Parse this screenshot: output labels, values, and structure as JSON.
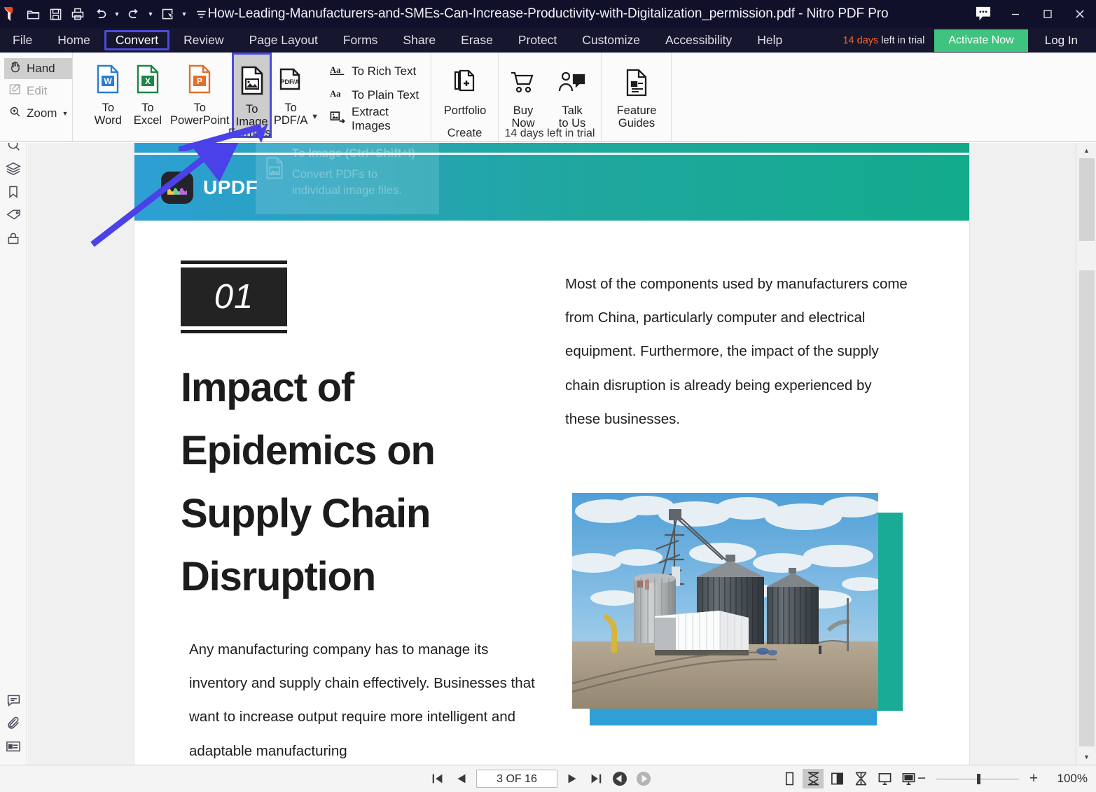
{
  "window": {
    "title": "How-Leading-Manufacturers-and-SMEs-Can-Increase-Productivity-with-Digitalization_permission.pdf - Nitro PDF Pro",
    "quick_access": [
      "open-icon",
      "save-icon",
      "print-icon",
      "undo-icon",
      "redo-icon",
      "select-icon",
      "more-icon"
    ],
    "controls": {
      "chat": "chat-icon",
      "minimize": "–",
      "maximize": "□",
      "close": "✕"
    }
  },
  "menu": {
    "items": [
      {
        "label": "File",
        "active": false
      },
      {
        "label": "Home",
        "active": false
      },
      {
        "label": "Convert",
        "active": true
      },
      {
        "label": "Review",
        "active": false
      },
      {
        "label": "Page Layout",
        "active": false
      },
      {
        "label": "Forms",
        "active": false
      },
      {
        "label": "Share",
        "active": false
      },
      {
        "label": "Erase",
        "active": false
      },
      {
        "label": "Protect",
        "active": false
      },
      {
        "label": "Customize",
        "active": false
      },
      {
        "label": "Accessibility",
        "active": false
      },
      {
        "label": "Help",
        "active": false
      }
    ],
    "trial_days": "14 days",
    "trial_rest": " left in trial",
    "activate_label": "Activate Now",
    "login_label": "Log In",
    "accent_green": "#3fc37e",
    "accent_orange": "#f4652c",
    "highlight_blue": "#4b4bdd"
  },
  "ribbon": {
    "tools": [
      {
        "label": "Hand",
        "icon": "hand-icon",
        "state": "selected"
      },
      {
        "label": "Edit",
        "icon": "edit-icon",
        "state": "disabled"
      },
      {
        "label": "Zoom",
        "icon": "zoom-icon",
        "state": "normal"
      }
    ],
    "formats_group_label": "Formats",
    "format_buttons": [
      {
        "line1": "To",
        "line2": "Word",
        "icon": "word-icon",
        "highlighted": false
      },
      {
        "line1": "To",
        "line2": "Excel",
        "icon": "excel-icon",
        "highlighted": false
      },
      {
        "line1": "To",
        "line2": "PowerPoint",
        "icon": "powerpoint-icon",
        "highlighted": false
      },
      {
        "line1": "To",
        "line2": "Image",
        "icon": "image-icon",
        "highlighted": true
      },
      {
        "line1": "To",
        "line2": "PDF/A",
        "icon": "pdfa-icon",
        "highlighted": false
      }
    ],
    "text_commands": [
      {
        "label": "To Rich Text",
        "icon": "rich-text-icon"
      },
      {
        "label": "To Plain Text",
        "icon": "plain-text-icon"
      },
      {
        "label": "Extract Images",
        "icon": "extract-images-icon"
      }
    ],
    "create_group_label": "Create",
    "create_buttons": [
      {
        "label": "Portfolio",
        "icon": "portfolio-icon"
      }
    ],
    "trial_group_label": "14 days left in trial",
    "trial_buttons": [
      {
        "line1": "Buy",
        "line2": "Now",
        "icon": "cart-icon"
      },
      {
        "line1": "Talk",
        "line2": "to Us",
        "icon": "talk-icon"
      }
    ],
    "guides_buttons": [
      {
        "line1": "Feature",
        "line2": "Guides",
        "icon": "feature-guides-icon"
      }
    ]
  },
  "left_rail": {
    "top_icons": [
      "search-icon",
      "pages-icon",
      "bookmark-icon",
      "tag-icon",
      "lock-icon"
    ],
    "bottom_icons": [
      "comment-icon",
      "attachment-icon",
      "layers-panel-icon"
    ]
  },
  "tooltip": {
    "title": "To Image (Ctrl+Shift+I)",
    "line1": "Convert PDFs to",
    "line2": "individual image files."
  },
  "document": {
    "brand": "UPDF",
    "section_number": "01",
    "headline": "Impact of Epidemics on Supply Chain Disruption",
    "right_paragraph": "Most of the components used by manufacturers come from China, particularly computer and electrical equipment. Furthermore, the impact of the supply chain disruption is already being experienced by these businesses.",
    "left_paragraph": "Any manufacturing company has to manage its inventory and supply chain effectively. Businesses that want to increase output require more intelligent and adaptable manufacturing",
    "photo_alt": "grain-silos-photo",
    "banner_gradient_start": "#2e9fd4",
    "banner_gradient_end": "#11a98a"
  },
  "status_bar": {
    "nav": {
      "first": "first-page-icon",
      "prev": "previous-page-icon",
      "page_value": "3 OF 16",
      "next": "next-page-icon",
      "last": "last-page-icon",
      "back": "navigate-back-icon",
      "forward": "navigate-forward-icon"
    },
    "view_modes": [
      {
        "name": "single-page-view",
        "selected": false
      },
      {
        "name": "continuous-view",
        "selected": true
      },
      {
        "name": "facing-pages-view",
        "selected": false
      },
      {
        "name": "facing-continuous-view",
        "selected": false
      },
      {
        "name": "full-screen-view",
        "selected": false
      },
      {
        "name": "presentation-view",
        "selected": false
      }
    ],
    "zoom": {
      "minus": "−",
      "plus": "+",
      "level": "100%"
    }
  }
}
